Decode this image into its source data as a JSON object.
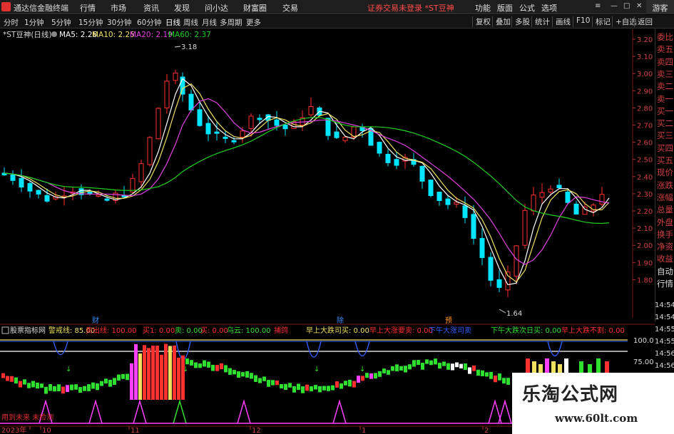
{
  "menubar": {
    "app_title": "通达信金融终端",
    "menus": [
      "行情",
      "市场",
      "资讯",
      "发现",
      "问小达",
      "财富圈",
      "交易"
    ],
    "notice": "证券交易未登录 *ST豆神",
    "right_menus": [
      "功能",
      "版面",
      "公式",
      "选项"
    ],
    "guest": "游客"
  },
  "toolbar": {
    "periods": [
      "分时",
      "1分钟",
      "5分钟",
      "15分钟",
      "30分钟",
      "60分钟",
      "日线",
      "周线",
      "月线",
      "多周期",
      "更多"
    ],
    "active_period": "日线",
    "right_buttons": [
      "复权",
      "叠加",
      "多股",
      "统计",
      "画线",
      "F10",
      "标记",
      "+自选",
      "返回"
    ]
  },
  "kline": {
    "stock_label": "*ST豆神(日线)",
    "ma5_label": "MA5: 2.26",
    "ma10_label": "MA10: 2.25",
    "ma20_label": "MA20: 2.19",
    "ma60_label": "MA60: 2.37",
    "high_label": "3.18",
    "low_label": "1.64",
    "price_ticks": [
      "3.20",
      "3.10",
      "3.00",
      "2.90",
      "2.80",
      "2.70",
      "2.60",
      "2.50",
      "2.40",
      "2.30",
      "2.20",
      "2.10",
      "2.00",
      "1.90",
      "1.80"
    ],
    "event_markers": [
      "财",
      "除",
      "预"
    ],
    "colors": {
      "up": "#ff3030",
      "down": "#00e5ff",
      "ma5": "#ffffff",
      "ma10": "#f0e060",
      "ma20": "#e040e0",
      "ma60": "#20d020"
    }
  },
  "side_panel": {
    "items": [
      "委比",
      "卖五",
      "卖四",
      "卖三",
      "卖二",
      "卖一",
      "买一",
      "买二",
      "买三",
      "买四",
      "买五",
      "现价",
      "涨跌",
      "涨幅",
      "总量",
      "外盘",
      "换手",
      "净资",
      "收益",
      "自动",
      "行情"
    ],
    "time_items": [
      "14:54",
      "14:54",
      "14:55",
      "14:55",
      "14:56",
      "14:56"
    ]
  },
  "indicator": {
    "name": "股票指标网",
    "items": [
      {
        "label": "警戒线: 85.00",
        "color": "#f0e060"
      },
      {
        "label": "卖出线: 100.00",
        "color": "#ff3030"
      },
      {
        "label": "买1: 0.00",
        "color": "#ff3030"
      },
      {
        "label": "卖: 0.00",
        "color": "#30e030"
      },
      {
        "label": "买: 0.00",
        "color": "#ff3030"
      },
      {
        "label": "乌云: 100.00",
        "color": "#30e030"
      },
      {
        "label": "捕鸽",
        "color": "#ff3030"
      },
      {
        "label": "早上大跌司买: 0.00",
        "color": "#f0e060"
      },
      {
        "label": "早上大涨要卖: 0.00",
        "color": "#ff3030"
      },
      {
        "label": "下午大涨司卖",
        "color": "#3060ff"
      },
      {
        "label": "下午大跌次日买: 0.00",
        "color": "#30e030"
      },
      {
        "label": "早上大跌不割: 0.00",
        "color": "#ff3030"
      }
    ],
    "y_ticks": [
      "100.0",
      "75.00"
    ],
    "footer_left": "用到未来 未检测",
    "date_labels": [
      "2023年",
      "10",
      "11",
      "12",
      "1",
      "2"
    ]
  },
  "watermark": {
    "title": "乐淘公式网",
    "url": "www.60lt.com"
  }
}
